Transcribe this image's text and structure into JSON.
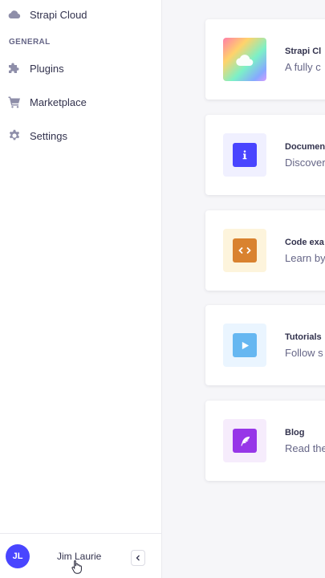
{
  "sidebar": {
    "top_item": {
      "label": "Strapi Cloud",
      "icon": "cloud-icon"
    },
    "section_label": "GENERAL",
    "items": [
      {
        "label": "Plugins",
        "icon": "puzzle-icon"
      },
      {
        "label": "Marketplace",
        "icon": "cart-icon"
      },
      {
        "label": "Settings",
        "icon": "gear-icon"
      }
    ],
    "footer": {
      "initials": "JL",
      "name": "Jim Laurie"
    }
  },
  "cards": [
    {
      "title": "Strapi Cl",
      "desc": "A fully c",
      "icon": "cloud-gradient-icon"
    },
    {
      "title": "Documen",
      "desc": "Discover",
      "icon": "info-icon"
    },
    {
      "title": "Code exa",
      "desc": "Learn by",
      "icon": "code-icon"
    },
    {
      "title": "Tutorials",
      "desc": "Follow s",
      "icon": "play-icon"
    },
    {
      "title": "Blog",
      "desc": "Read the",
      "icon": "feather-icon"
    }
  ],
  "colors": {
    "accent": "#4945ff",
    "docs": "#4945ff",
    "code": "#d9822f",
    "tutorials": "#66b7f1",
    "blog": "#9736e8"
  }
}
